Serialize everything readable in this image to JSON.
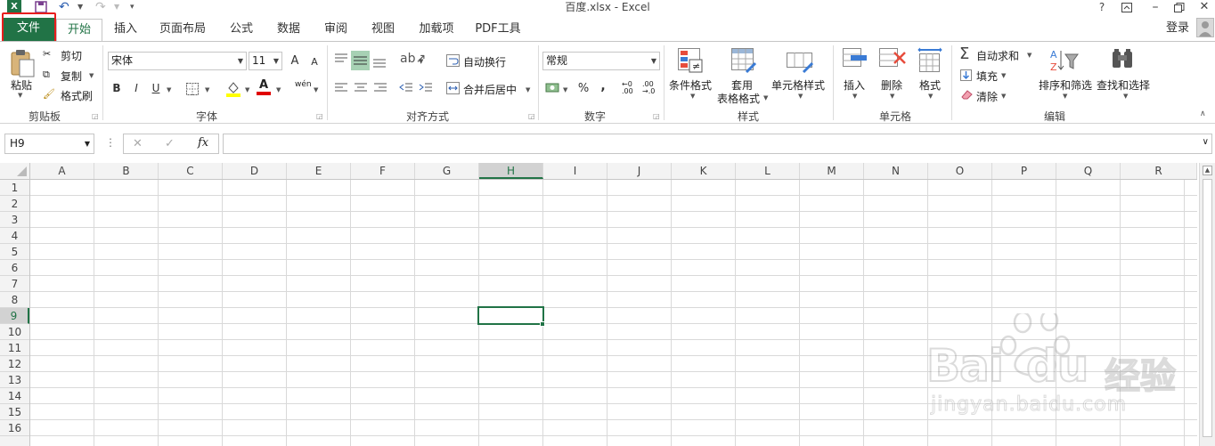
{
  "window": {
    "title": "百度.xlsx - Excel",
    "help": "?",
    "signin": "登录"
  },
  "tabs": [
    {
      "label": "文件"
    },
    {
      "label": "开始"
    },
    {
      "label": "插入"
    },
    {
      "label": "页面布局"
    },
    {
      "label": "公式"
    },
    {
      "label": "数据"
    },
    {
      "label": "审阅"
    },
    {
      "label": "视图"
    },
    {
      "label": "加载项"
    },
    {
      "label": "PDF工具"
    }
  ],
  "ribbon": {
    "clipboard": {
      "group": "剪贴板",
      "paste": "粘贴",
      "cut": "剪切",
      "copy": "复制",
      "format_painter": "格式刷"
    },
    "font": {
      "group": "字体",
      "font_name": "宋体",
      "font_size": "11",
      "bold": "B",
      "italic": "I",
      "underline": "U",
      "grow": "A",
      "shrink": "A",
      "font_color": "A",
      "phonetic": "wén"
    },
    "alignment": {
      "group": "对齐方式",
      "wrap": "自动换行",
      "merge": "合并后居中"
    },
    "number": {
      "group": "数字",
      "format": "常规",
      "percent": "%",
      "comma": ","
    },
    "styles": {
      "group": "样式",
      "conditional": "条件格式",
      "table_format_1": "套用",
      "table_format_2": "表格格式",
      "cell_styles": "单元格样式"
    },
    "cells": {
      "group": "单元格",
      "insert": "插入",
      "delete": "删除",
      "format": "格式"
    },
    "editing": {
      "group": "编辑",
      "autosum": "自动求和",
      "fill": "填充",
      "clear": "清除",
      "sort_filter": "排序和筛选",
      "find_select": "查找和选择"
    }
  },
  "formula_bar": {
    "name_box": "H9",
    "fx": "fx",
    "value": ""
  },
  "grid": {
    "columns": [
      "A",
      "B",
      "C",
      "D",
      "E",
      "F",
      "G",
      "H",
      "I",
      "J",
      "K",
      "L",
      "M",
      "N",
      "O",
      "P",
      "Q",
      "R"
    ],
    "rows": [
      "1",
      "2",
      "3",
      "4",
      "5",
      "6",
      "7",
      "8",
      "9",
      "10",
      "11",
      "12",
      "13",
      "14",
      "15",
      "16"
    ],
    "selected_column": "H",
    "selected_row": "9"
  },
  "watermark": {
    "text1": "Bai",
    "text2": "du",
    "text3": "经验",
    "url": "jingyan.baidu.com"
  },
  "colors": {
    "excel_green": "#217346",
    "highlight_red": "#e81d1d"
  }
}
